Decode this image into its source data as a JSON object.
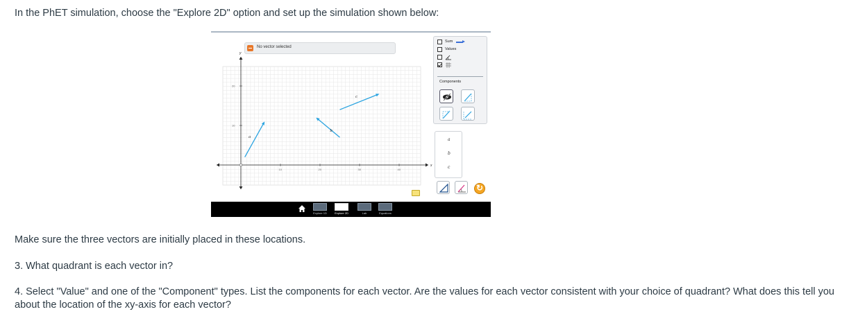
{
  "question": {
    "intro": "In the PhET simulation, choose the \"Explore 2D\" option and set up the simulation shown below:",
    "note": "Make sure the three vectors are initially placed in these locations.",
    "q3": "3. What quadrant is each vector in?",
    "q4": "4. Select \"Value\" and one of the \"Component\" types. List the components for each vector. Are the values for each vector consistent with your choice of quadrant? What does this tell you about the location of the xy-axis for each vector?"
  },
  "simulation": {
    "status_label": "No vector selected",
    "checkboxes": [
      {
        "label": "Sum",
        "checked": false
      },
      {
        "label": "Values",
        "checked": false
      },
      {
        "label": "",
        "checked": false
      },
      {
        "label": "",
        "checked": true
      }
    ],
    "components_label": "Components",
    "toolbox_vectors": [
      "a",
      "b",
      "c"
    ],
    "axis": {
      "x_label": "x",
      "y_label": "y",
      "x_ticks": [
        "10",
        "20",
        "30",
        "40"
      ],
      "y_ticks": [
        "10",
        "20"
      ]
    },
    "vectors": [
      {
        "name": "a",
        "tail": [
          1,
          2
        ],
        "tip": [
          6,
          11
        ]
      },
      {
        "name": "b",
        "tail": [
          25,
          7
        ],
        "tip": [
          19,
          12
        ]
      },
      {
        "name": "c",
        "tail": [
          25,
          14
        ],
        "tip": [
          35,
          18
        ]
      }
    ],
    "vector_color": "#2aa3e0",
    "nav": {
      "tabs": [
        "Explore 1D",
        "Explore 2D",
        "Lab",
        "Equations"
      ],
      "selected": "Explore 2D"
    }
  }
}
